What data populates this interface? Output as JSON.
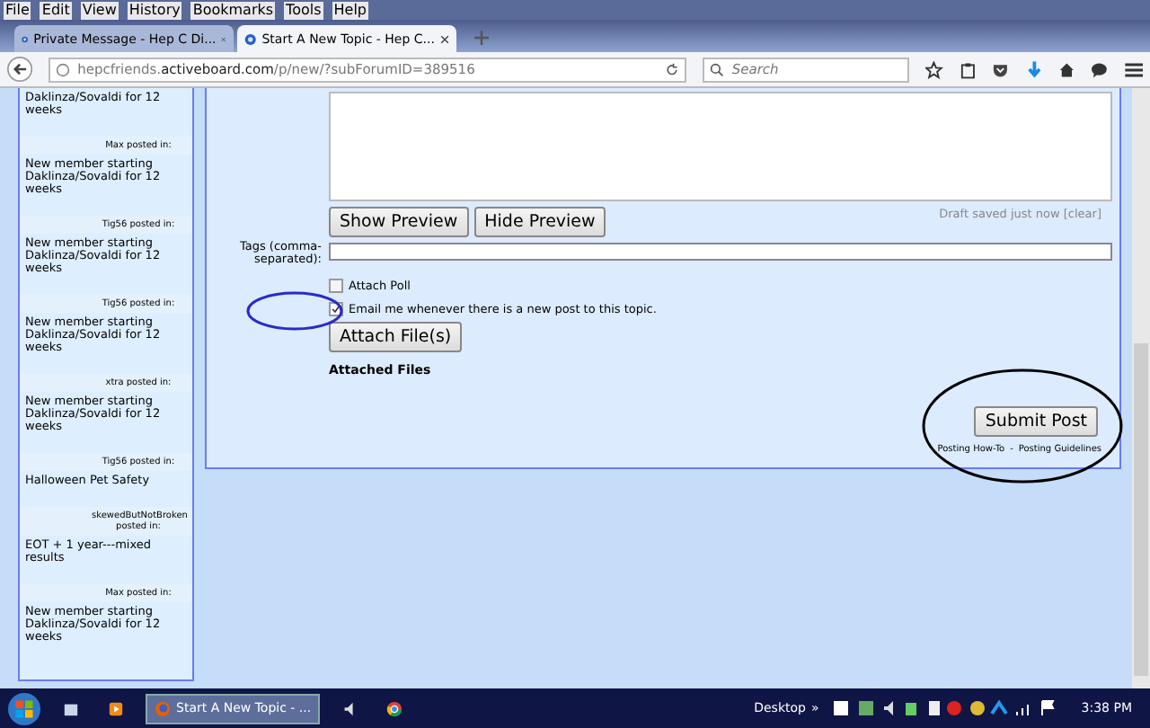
{
  "menu": [
    "File",
    "Edit",
    "View",
    "History",
    "Bookmarks",
    "Tools",
    "Help"
  ],
  "tabs": [
    {
      "label": "Private Message - Hep C Di...",
      "selected": false
    },
    {
      "label": "Start A New Topic - Hep C...",
      "selected": true
    }
  ],
  "address": {
    "url": "hepcfriends.**activeboard.com**/p/new/?subForumID=389516"
  },
  "search": {
    "placeholder": "Search"
  },
  "sidebar": {
    "posts": [
      {
        "title": "Daklinza/Sovaldi for 12 weeks"
      },
      {
        "author": "Max posted in:",
        "title": "New member starting Daklinza/Sovaldi for 12 weeks"
      },
      {
        "author": "Tig56 posted in:",
        "title": "New member starting Daklinza/Sovaldi for 12 weeks"
      },
      {
        "author": "Tig56 posted in:",
        "title": "New member starting Daklinza/Sovaldi for 12 weeks"
      },
      {
        "author": "xtra posted in:",
        "title": "New member starting Daklinza/Sovaldi for 12 weeks"
      },
      {
        "author": "Tig56 posted in:",
        "title": "Halloween Pet Safety"
      },
      {
        "author": "skewedButNotBroken posted in:",
        "title": "EOT + 1 year---mixed results"
      },
      {
        "author": "Max posted in:",
        "title": "New member starting Daklinza/Sovaldi for 12 weeks"
      }
    ]
  },
  "editor": {
    "preview_buttons": [
      "Show Preview",
      "Hide Preview"
    ],
    "draft_status": "Draft saved just now [clear]",
    "tags_label": "Tags (comma-separated):",
    "options": [
      {
        "label": "Attach Poll",
        "checked": false
      },
      {
        "label": "Email me whenever there is a new post to this topic.",
        "checked": true
      }
    ],
    "attach_button": "Attach File(s)",
    "attached_files_heading": "Attached Files",
    "submit_button": "Submit Post",
    "footer_links": [
      "Posting How-To",
      "Posting Guidelines"
    ],
    "footer_separator": "-"
  },
  "taskbar": {
    "window_task": "Start A New Topic - ...",
    "desktop_label": "Desktop",
    "chevron": "»",
    "clock": "3:38 PM"
  }
}
